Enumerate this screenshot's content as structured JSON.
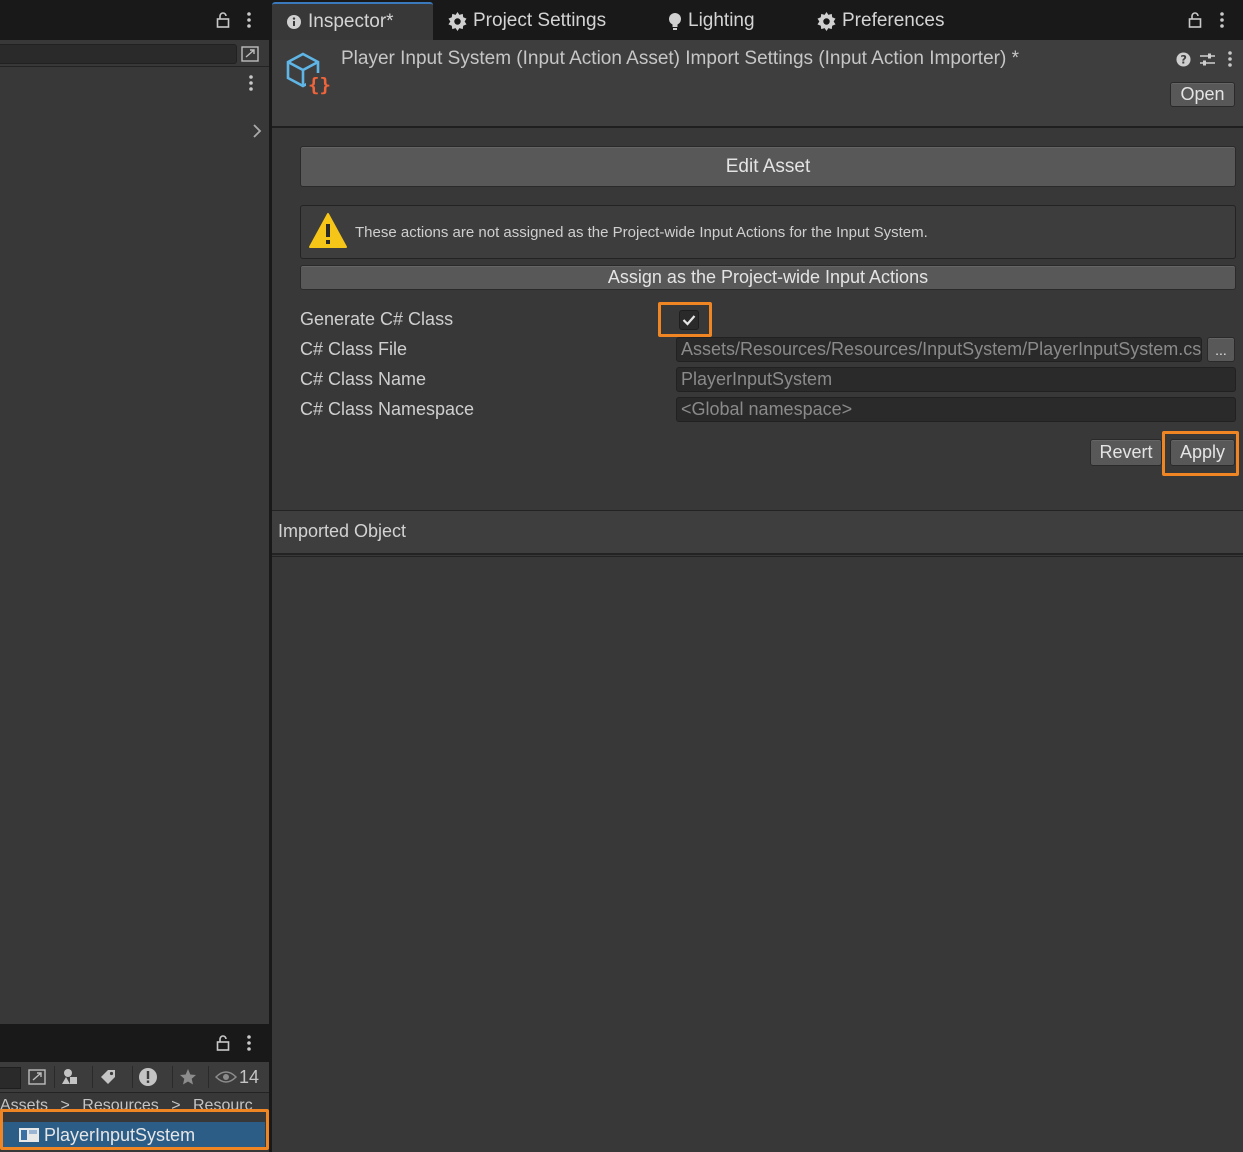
{
  "left_panel": {
    "search_value": "",
    "project_toolbar": {
      "visibility_count": "14"
    },
    "breadcrumb": [
      "Assets",
      "Resources",
      "Resourc"
    ],
    "breadcrumb_separator": ">",
    "selected_asset": "PlayerInputSystem"
  },
  "tabs": [
    {
      "label": "Inspector*",
      "icon": "info-icon",
      "active": true
    },
    {
      "label": "Project Settings",
      "icon": "gear-icon",
      "active": false
    },
    {
      "label": "Lighting",
      "icon": "lightbulb-icon",
      "active": false
    },
    {
      "label": "Preferences",
      "icon": "gear-icon",
      "active": false
    }
  ],
  "header": {
    "title": "Player Input System (Input Action Asset) Import Settings (Input Action Importer) *",
    "open_label": "Open",
    "asset_icon": "input-action-asset-icon"
  },
  "body": {
    "edit_asset_label": "Edit Asset",
    "warning_text": "These actions are not assigned as the Project-wide Input Actions for the Input System.",
    "assign_label": "Assign as the Project-wide Input Actions",
    "fields": {
      "generate_label": "Generate C# Class",
      "generate_checked": true,
      "class_file_label": "C# Class File",
      "class_file_value": "Assets/Resources/Resources/InputSystem/PlayerInputSystem.cs",
      "browse_label": "...",
      "class_name_label": "C# Class Name",
      "class_name_placeholder": "PlayerInputSystem",
      "namespace_label": "C# Class Namespace",
      "namespace_placeholder": "<Global namespace>"
    },
    "revert_label": "Revert",
    "apply_label": "Apply",
    "imported_object_label": "Imported Object"
  },
  "colors": {
    "highlight": "#f08623",
    "selection": "#2c5d87",
    "warning": "#f5c518"
  }
}
